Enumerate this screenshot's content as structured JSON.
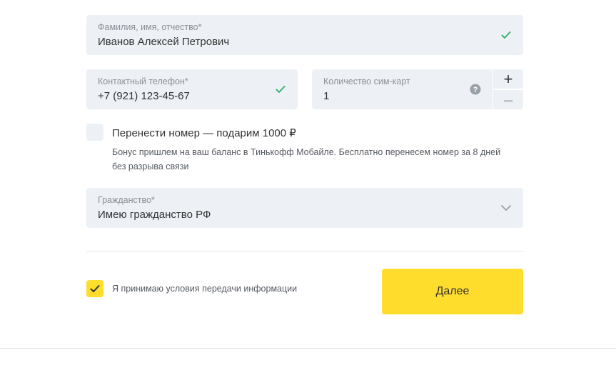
{
  "form": {
    "full_name": {
      "label": "Фамилия, имя, отчество*",
      "value": "Иванов Алексей Петрович",
      "valid": true
    },
    "phone": {
      "label": "Контактный телефон*",
      "value": "+7 (921) 123-45-67",
      "valid": true
    },
    "sim_count": {
      "label": "Количество сим-карт",
      "value": "1",
      "help_icon": "question-circle-icon",
      "plus_label": "+",
      "minus_label": "–"
    },
    "transfer_number": {
      "checked": false,
      "label": "Перенести номер — подарим 1000 ₽",
      "description_line1": "Бонус пришлем на ваш баланс в Тинькофф Мобайле. Бесплатно перенесем номер за 8 дней",
      "description_line2": "без разрыва связи"
    },
    "citizenship": {
      "label": "Гражданство*",
      "value": "Имею гражданство РФ",
      "icon": "chevron-down-icon"
    },
    "consent": {
      "checked": true,
      "label": "Я принимаю условия передачи информации"
    },
    "submit_label": "Далее"
  },
  "colors": {
    "field_bg": "#edf1f6",
    "valid_check": "#3cb371",
    "accent_yellow": "#ffdd2d",
    "label_gray": "#8a8f96"
  }
}
